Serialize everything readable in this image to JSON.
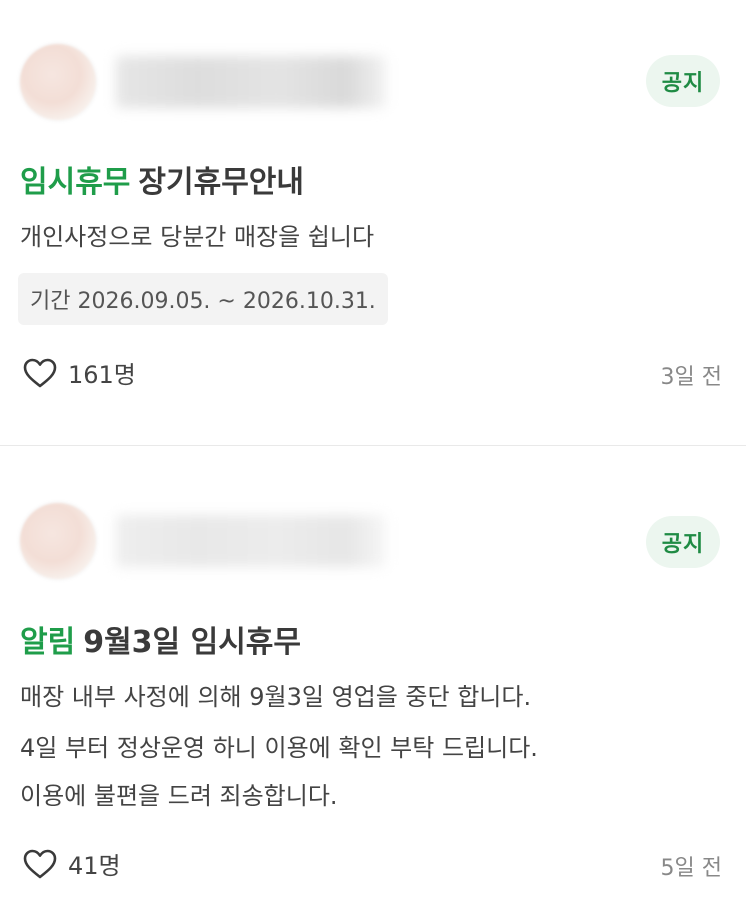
{
  "posts": [
    {
      "badge": "공지",
      "tag": "임시휴무",
      "title": "장기휴무안내",
      "body": [
        "개인사정으로 당분간 매장을 쉽니다"
      ],
      "period": "기간 2026.09.05. ~ 2026.10.31.",
      "likes": "161명",
      "time": "3일 전"
    },
    {
      "badge": "공지",
      "tag": "알림",
      "title": "9월3일 임시휴무",
      "body": [
        "매장 내부 사정에 의해 9월3일 영업을 중단 합니다.",
        "4일 부터 정상운영 하니 이용에 확인 부탁 드립니다.",
        "이용에 불편을 드려 죄송합니다."
      ],
      "likes": "41명",
      "time": "5일 전"
    }
  ],
  "icons": {
    "like": "heart-outline-icon"
  },
  "colors": {
    "accent": "#1f9d4a",
    "badge_bg": "#ecf6ef",
    "badge_text": "#1f8b44"
  }
}
